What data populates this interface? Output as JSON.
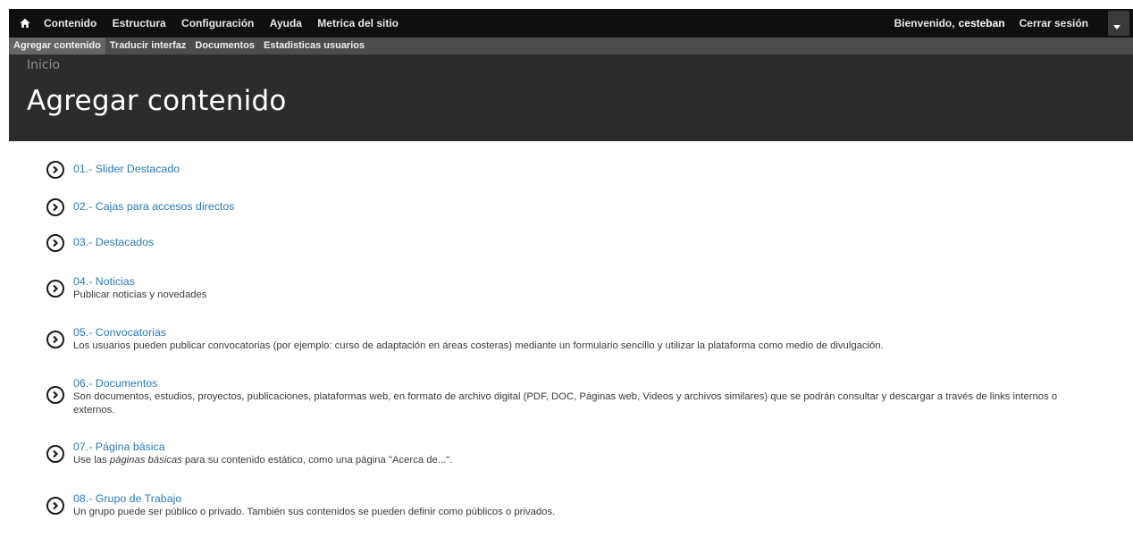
{
  "toolbar": {
    "menu": [
      "Contenido",
      "Estructura",
      "Configuración",
      "Ayuda",
      "Metrica del sitio"
    ],
    "welcome_prefix": "Bienvenido,",
    "username": "cesteban",
    "logout": "Cerrar sesión"
  },
  "tray": {
    "items": [
      "Agregar contenido",
      "Traducir interfaz",
      "Documentos",
      "Estadisticas usuarios"
    ]
  },
  "header": {
    "breadcrumb": "Inicio",
    "title": "Agregar contenido"
  },
  "content_types": [
    {
      "label": "01.- Slider Destacado",
      "description": ""
    },
    {
      "label": "02.- Cajas para accesos directos",
      "description": ""
    },
    {
      "label": "03.- Destacados",
      "description": ""
    },
    {
      "label": "04.- Noticias",
      "description": "Publicar noticias y novedades"
    },
    {
      "label": "05.- Convocatorias",
      "description": "Los usuarios pueden publicar convocatorias (por ejemplo: curso de adaptación en áreas costeras) mediante un formulario sencillo y utilizar la plataforma como medio de divulgación."
    },
    {
      "label": "06.- Documentos",
      "description": "Son documentos, estudios, proyectos, publicaciones, plataformas web, en formato de archivo digital (PDF, DOC, Páginas web, Videos y archivos similares) que se podrán consultar y descargar a través de links internos o externos."
    },
    {
      "label": "07.- Página básica",
      "description_pre": "Use las ",
      "description_em": "páginas básicas",
      "description_post": " para su contenido estático, como una página \"Acerca de...\"."
    },
    {
      "label": "08.- Grupo de Trabajo",
      "description": "Un grupo puede ser público o privado. También sus contenidos se pueden definir como públicos o privados."
    }
  ]
}
